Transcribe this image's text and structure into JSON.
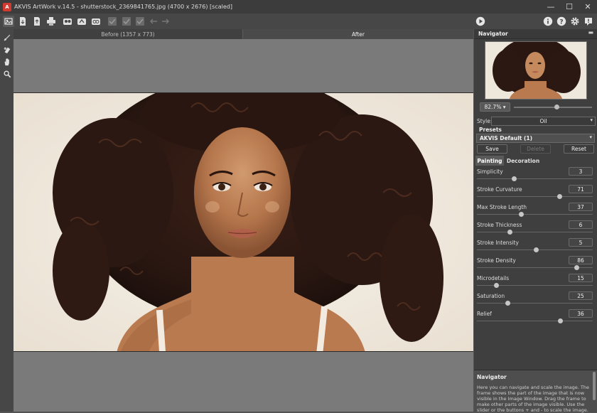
{
  "window": {
    "title": "AKVIS ArtWork v.14.5 - shutterstock_2369841765.jpg (4700 x 2676) [scaled]",
    "logo_letter": "A",
    "minimize": "—",
    "maximize": "☐",
    "close": "✕"
  },
  "toolbar": {
    "icons": [
      "home-icon",
      "open-file-icon",
      "save-file-icon",
      "print-icon",
      "batch-icon",
      "share-icon",
      "plugin-icon",
      "apply-check-icon",
      "apply-check2-icon",
      "apply-check3-icon",
      "undo-arrow-icon",
      "redo-arrow-icon"
    ],
    "right_icons": [
      "run-play-icon",
      "info-icon",
      "help-icon",
      "settings-gear-icon",
      "notification-icon"
    ]
  },
  "canvas": {
    "tab_before": "Before (1357 x 773)",
    "tab_after": "After"
  },
  "navigator": {
    "title": "Navigator",
    "zoom": "82.7%",
    "zoom_level": 0.55
  },
  "style": {
    "label": "Style:",
    "value": "Oil"
  },
  "presets": {
    "label": "Presets",
    "value": "AKVIS Default (1)",
    "save": "Save",
    "delete": "Delete",
    "reset": "Reset"
  },
  "tabs": {
    "painting": "Painting",
    "decoration": "Decoration"
  },
  "params": [
    {
      "label": "Simplicity",
      "value": "3",
      "level": 0.31
    },
    {
      "label": "Stroke Curvature",
      "value": "71",
      "level": 0.71
    },
    {
      "label": "Max Stroke Length",
      "value": "37",
      "level": 0.37
    },
    {
      "label": "Stroke Thickness",
      "value": "6",
      "level": 0.27
    },
    {
      "label": "Stroke Intensity",
      "value": "5",
      "level": 0.5
    },
    {
      "label": "Stroke Density",
      "value": "86",
      "level": 0.86
    },
    {
      "label": "Microdetails",
      "value": "15",
      "level": 0.15
    },
    {
      "label": "Saturation",
      "value": "25",
      "level": 0.25
    },
    {
      "label": "Relief",
      "value": "36",
      "level": 0.72
    }
  ],
  "help": {
    "title": "Navigator",
    "text": "Here you can navigate and scale the image. The frame shows the part of the image that is now visible in the Image Window. Drag the frame to make other parts of the image visible. Use the slider or the buttons + and - to scale the image."
  },
  "colors": {
    "accent_logo": "#d23a2f",
    "panel_bg": "#3f3f3f",
    "canvas_bg": "#7a7a7a"
  }
}
